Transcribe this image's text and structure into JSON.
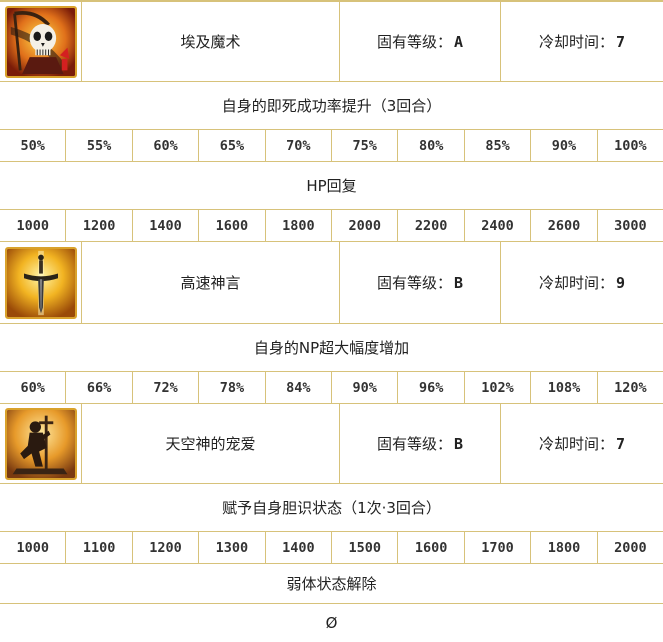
{
  "skills": [
    {
      "icon": "skull-reaper-icon",
      "name": "埃及魔术",
      "rank_label": "固有等级：",
      "rank_value": "A",
      "cd_label": "冷却时间：",
      "cd_value": "7",
      "effects": [
        {
          "label": "自身的即死成功率提升（3回合）",
          "values": [
            "50%",
            "55%",
            "60%",
            "65%",
            "70%",
            "75%",
            "80%",
            "85%",
            "90%",
            "100%"
          ]
        },
        {
          "label": "HP回复",
          "values": [
            "1000",
            "1200",
            "1400",
            "1600",
            "1800",
            "2000",
            "2200",
            "2400",
            "2600",
            "3000"
          ]
        }
      ]
    },
    {
      "icon": "sword-icon",
      "name": "高速神言",
      "rank_label": "固有等级：",
      "rank_value": "B",
      "cd_label": "冷却时间：",
      "cd_value": "9",
      "effects": [
        {
          "label": "自身的NP超大幅度增加",
          "values": [
            "60%",
            "66%",
            "72%",
            "78%",
            "84%",
            "90%",
            "96%",
            "102%",
            "108%",
            "120%"
          ]
        }
      ]
    },
    {
      "icon": "kneeling-knight-icon",
      "name": "天空神的宠爱",
      "rank_label": "固有等级：",
      "rank_value": "B",
      "cd_label": "冷却时间：",
      "cd_value": "7",
      "effects": [
        {
          "label": "赋予自身胆识状态（1次·3回合）",
          "values": [
            "1000",
            "1100",
            "1200",
            "1300",
            "1400",
            "1500",
            "1600",
            "1700",
            "1800",
            "2000"
          ]
        },
        {
          "label": "弱体状态解除",
          "final": "Ø"
        }
      ]
    }
  ],
  "colors": {
    "border": "#d7c27a",
    "icon_frame": "#d9a22c",
    "text": "#222222"
  }
}
